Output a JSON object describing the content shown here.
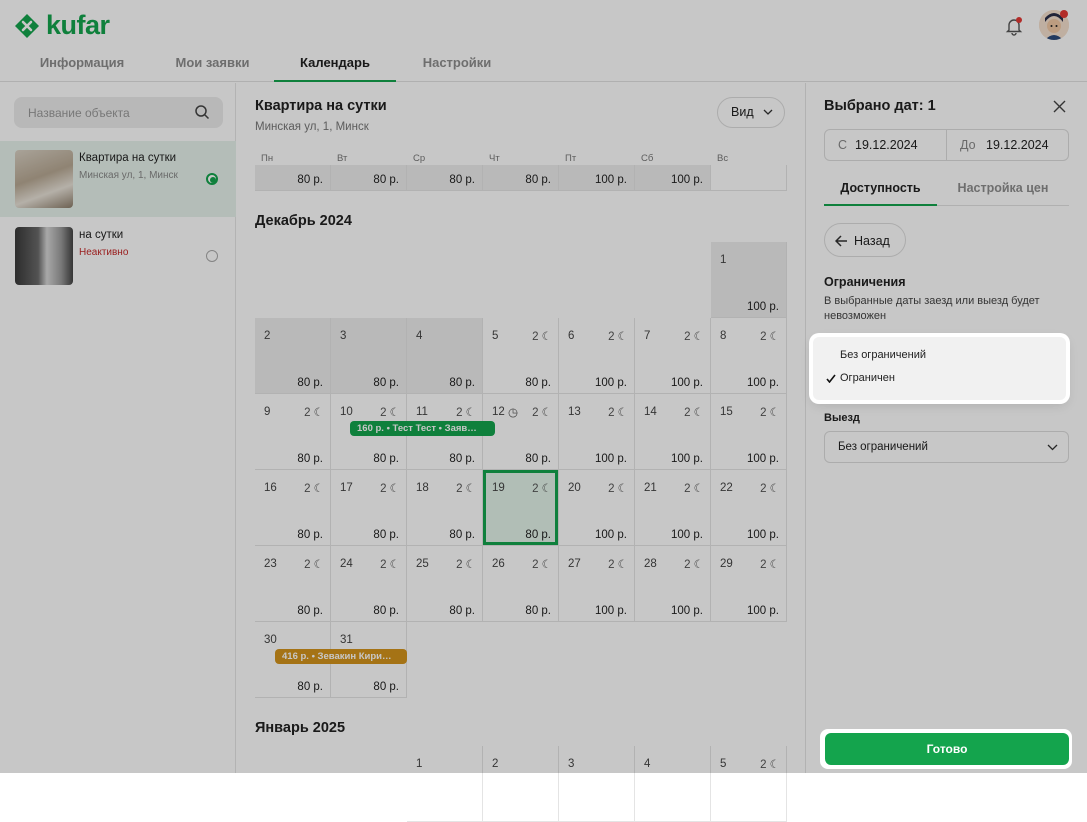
{
  "header": {
    "logo": "kufar",
    "tabs": [
      "Информация",
      "Мои заявки",
      "Календарь",
      "Настройки"
    ],
    "active_tab": "Календарь"
  },
  "sidebar": {
    "search_placeholder": "Название объекта",
    "objects": [
      {
        "title": "Квартира на сутки",
        "subtitle": "Минская ул, 1, Минск",
        "selected": true
      },
      {
        "title": "на сутки",
        "subtitle": "Неактивно",
        "selected": false
      }
    ]
  },
  "calendar": {
    "title": "Квартира на сутки",
    "address": "Минская ул, 1, Минск",
    "view_button": "Вид",
    "weekdays": [
      "Пн",
      "Вт",
      "Ср",
      "Чт",
      "Пт",
      "Сб",
      "Вс"
    ],
    "prev_prices": [
      "80 р.",
      "80 р.",
      "80 р.",
      "80 р.",
      "100 р.",
      "100 р."
    ],
    "month1": "Декабрь 2024",
    "month2": "Январь 2025",
    "moon_label": "2",
    "bookings": [
      {
        "text": "160 р. • Тест Тест • Заяв…",
        "color": "#14a44d"
      },
      {
        "text": "416 р. • Зевакин Кири…",
        "color": "#d4941c"
      }
    ]
  },
  "panel": {
    "title": "Выбрано дат: 1",
    "from_label": "С",
    "from_value": "19.12.2024",
    "to_label": "До",
    "to_value": "19.12.2024",
    "tab_availability": "Доступность",
    "tab_prices": "Настройка цен",
    "back_button": "Назад",
    "restrictions_title": "Ограничения",
    "restrictions_desc": "В выбранные даты заезд или выезд будет невозможен",
    "checkin_options": [
      "Без ограничений",
      "Ограничен"
    ],
    "checkin_selected": "Ограничен",
    "checkout_label": "Выезд",
    "checkout_value": "Без ограничений",
    "done_button": "Готово"
  },
  "colors": {
    "brand": "#14a44d",
    "booking2": "#d4941c"
  }
}
